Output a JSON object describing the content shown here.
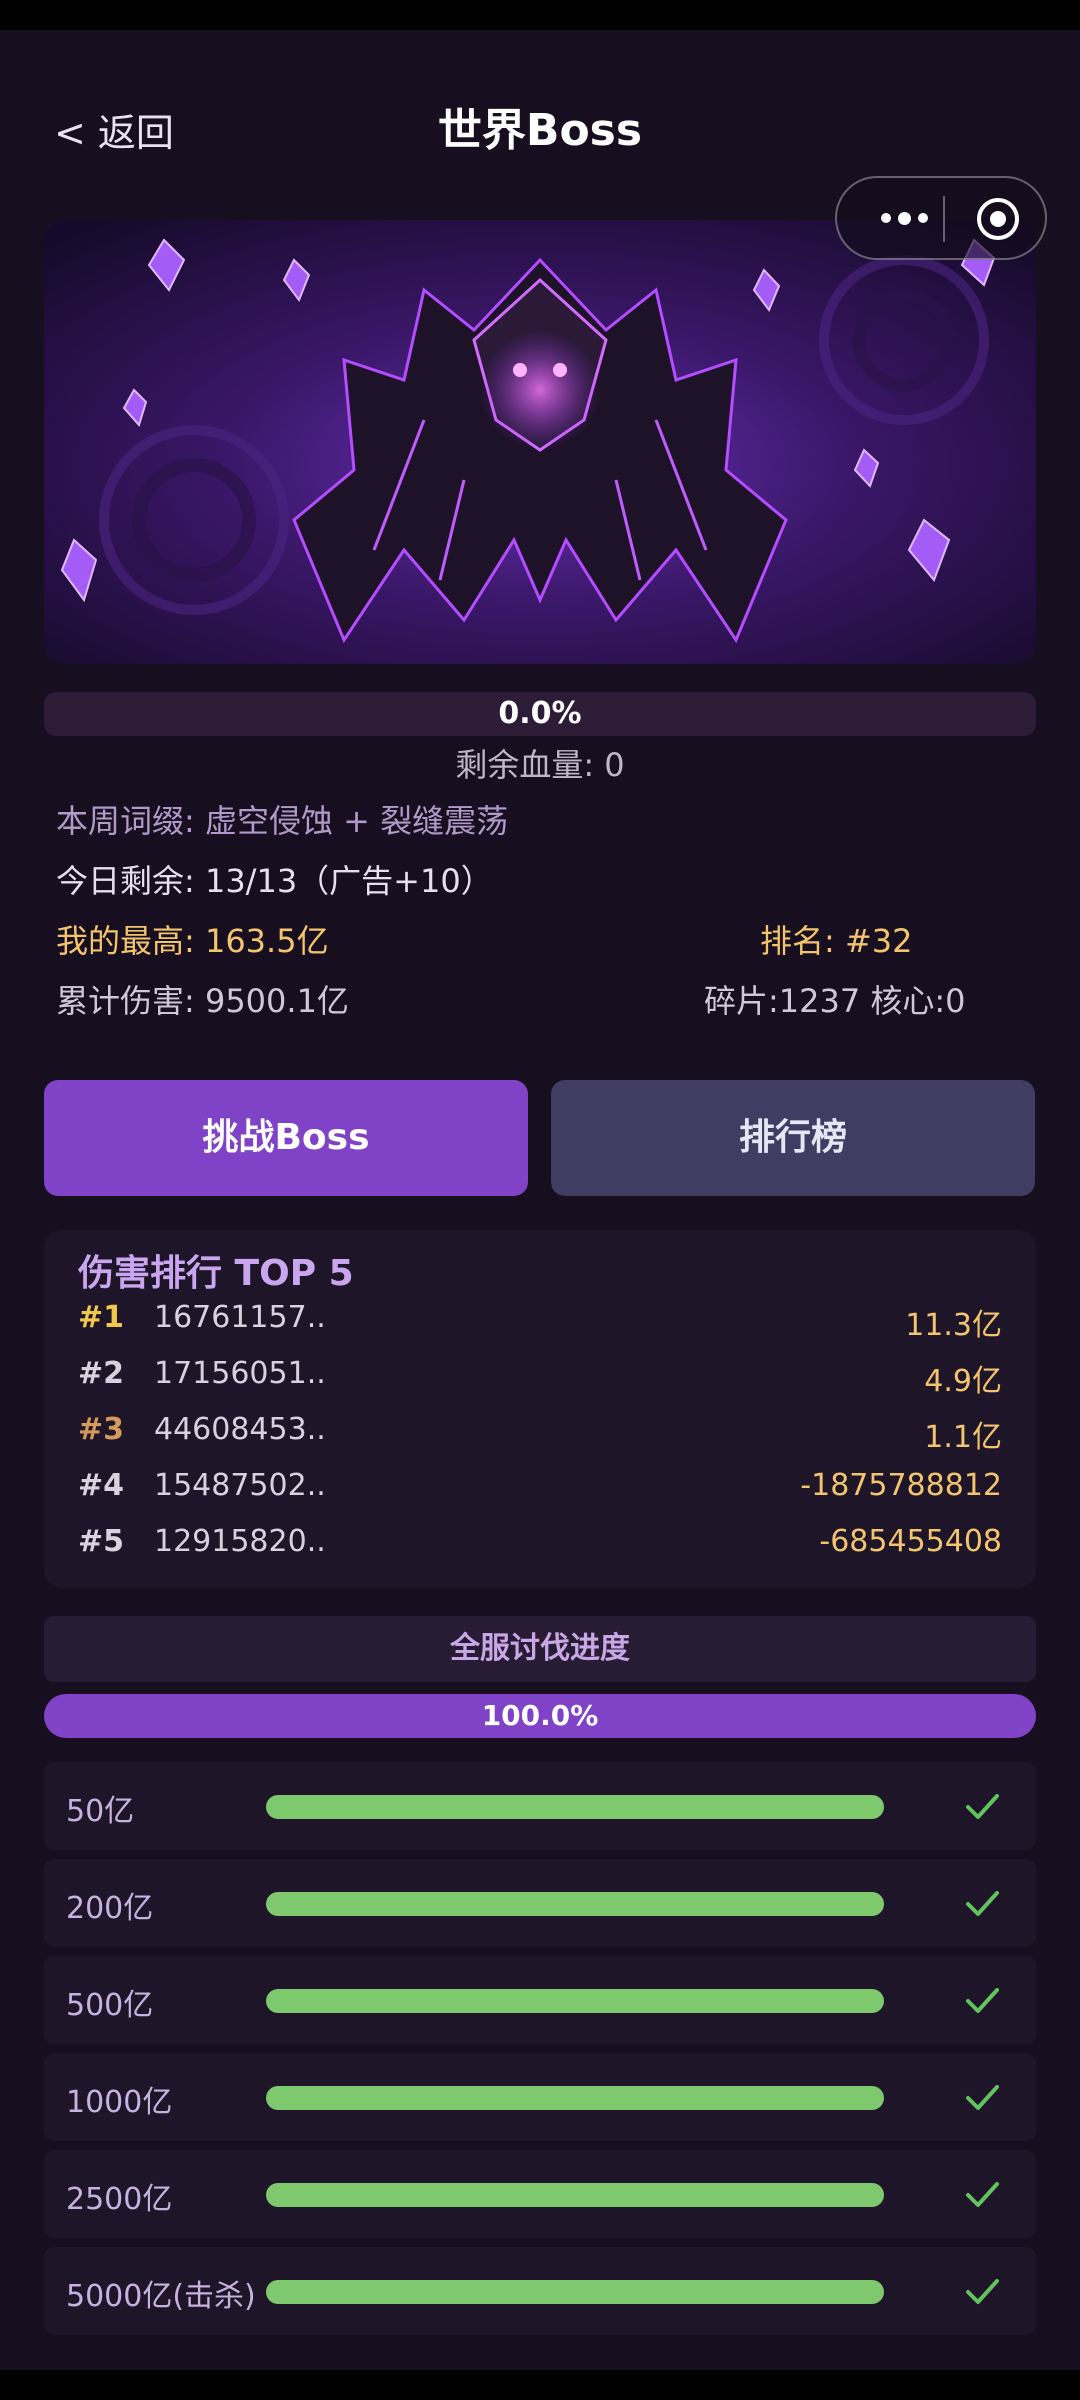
{
  "header": {
    "back_label": "< 返回",
    "title": "世界Boss"
  },
  "boss": {
    "hp_percent_label": "0.0%",
    "hp_fraction": 0.0,
    "hp_remaining_label": "剩余血量: 0"
  },
  "info": {
    "affix": "本周词缀: 虚空侵蚀 + 裂缝震荡",
    "today": "今日剩余: 13/13（广告+10）",
    "best": "我的最高: 163.5亿",
    "rank": "排名: #32",
    "total_damage": "累计伤害: 9500.1亿",
    "shards": "碎片:1237  核心:0"
  },
  "buttons": {
    "challenge": "挑战Boss",
    "leaderboard": "排行榜"
  },
  "top5": {
    "title": "伤害排行 TOP 5",
    "rows": [
      {
        "rank": "#1",
        "uid": "16761157..",
        "damage": "11.3亿",
        "rank_color": "#f1c94a"
      },
      {
        "rank": "#2",
        "uid": "17156051..",
        "damage": "4.9亿",
        "rank_color": "#d7d2de"
      },
      {
        "rank": "#3",
        "uid": "44608453..",
        "damage": "1.1亿",
        "rank_color": "#d49a5c"
      },
      {
        "rank": "#4",
        "uid": "15487502..",
        "damage": "-1875788812",
        "rank_color": "#d7d2de"
      },
      {
        "rank": "#5",
        "uid": "12915820..",
        "damage": "-685455408",
        "rank_color": "#d7d2de"
      }
    ]
  },
  "server_progress": {
    "title": "全服讨伐进度",
    "percent_label": "100.0%",
    "fraction": 1.0,
    "milestones": [
      {
        "label": "50亿",
        "fraction": 1.0,
        "done": true
      },
      {
        "label": "200亿",
        "fraction": 1.0,
        "done": true
      },
      {
        "label": "500亿",
        "fraction": 1.0,
        "done": true
      },
      {
        "label": "1000亿",
        "fraction": 1.0,
        "done": true
      },
      {
        "label": "2500亿",
        "fraction": 1.0,
        "done": true
      },
      {
        "label": "5000亿(击杀)",
        "fraction": 1.0,
        "done": true
      }
    ]
  },
  "colors": {
    "accent": "#8042c6",
    "gold": "#f2c46d",
    "progress_green": "#7ec86d",
    "background": "#170f1f"
  },
  "icons": {
    "menu": "more-dots-icon",
    "close": "target-circle-icon",
    "check": "check-icon"
  }
}
